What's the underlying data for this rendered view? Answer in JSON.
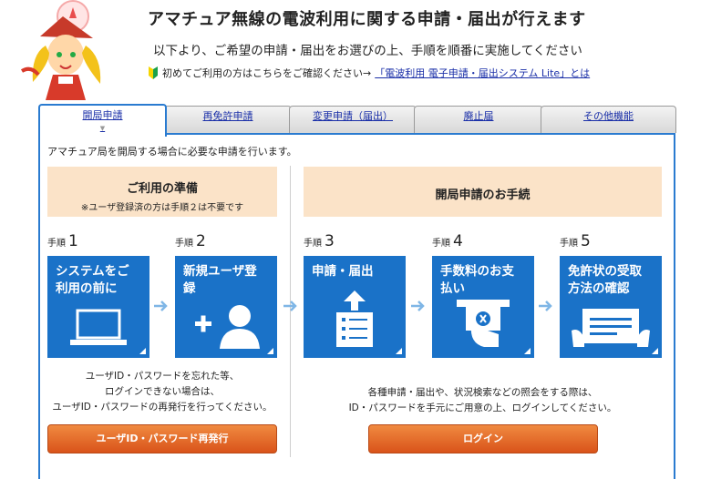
{
  "header": {
    "title": "アマチュア無線の電波利用に関する申請・届出が行えます",
    "subtitle": "以下より、ご希望の申請・届出をお選びの上、手順を順番に実施してください",
    "note_text": "初めてご利用の方はこちらをご確認ください→",
    "note_link": "「電波利用 電子申請・届出システム Lite」とは"
  },
  "tabs": [
    {
      "label": "開局申請"
    },
    {
      "label": "再免許申請"
    },
    {
      "label": "変更申請（届出）"
    },
    {
      "label": "廃止届"
    },
    {
      "label": "その他機能"
    }
  ],
  "intro": "アマチュア局を開局する場合に必要な申請を行います。",
  "prep": {
    "title": "ご利用の準備",
    "subtitle": "※ユーザ登録済の方は手順２は不要です"
  },
  "procedure": {
    "title": "開局申請のお手続"
  },
  "steps": [
    {
      "prefix": "手順",
      "num": "1",
      "title": "システムをご利用の前に"
    },
    {
      "prefix": "手順",
      "num": "2",
      "title": "新規ユーザ登録"
    },
    {
      "prefix": "手順",
      "num": "3",
      "title": "申請・届出"
    },
    {
      "prefix": "手順",
      "num": "4",
      "title": "手数料のお支払い"
    },
    {
      "prefix": "手順",
      "num": "5",
      "title": "免許状の受取方法の確認"
    }
  ],
  "left_desc": [
    "ユーザID・パスワードを忘れた等、",
    "ログインできない場合は、",
    "ユーザID・パスワードの再発行を行ってください。"
  ],
  "right_desc": [
    "各種申請・届出や、状況検索などの照会をする際は、",
    "ID・パスワードを手元にご用意の上、ログインしてください。"
  ],
  "buttons": {
    "reissue": "ユーザID・パスワード再発行",
    "login": "ログイン"
  },
  "colors": {
    "accent": "#2a7bd0",
    "card": "#1a72c8",
    "button": "#e06a28",
    "prep_bg": "#fbe3c8"
  }
}
